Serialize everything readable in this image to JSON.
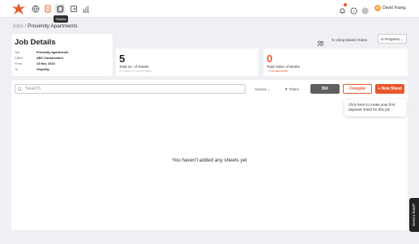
{
  "topbar": {
    "tooltip": "Sheets",
    "nav_icons": [
      "globe-icon",
      "document-icon",
      "sheets-icon",
      "export-icon",
      "chart-icon"
    ],
    "user": {
      "initials": "DY",
      "name": "David Young"
    },
    "accent": "#e8572a"
  },
  "breadcrumb": {
    "parent": "Jobs",
    "separator": "/",
    "current": "Proximity Apartments"
  },
  "job_details": {
    "title": "Job Details",
    "rows": [
      {
        "label": "Job",
        "value": "Proximity Apartments"
      },
      {
        "label": "Client",
        "value": "ABC Construction"
      },
      {
        "label": "From",
        "value": "13 Nov, 2024"
      },
      {
        "label": "To",
        "value": "Ongoing"
      }
    ]
  },
  "stats": {
    "sheets": {
      "value": "5",
      "label": "Total no. of sheets",
      "sub": "23 sheets in current stage"
    },
    "value_of_works": {
      "value": "0",
      "label": "Total Value of Works",
      "sub": "0 vs last month"
    }
  },
  "controls": {
    "master_rates": "Using Master Rates",
    "status": "In Progress"
  },
  "toolbar": {
    "search_placeholder": "Search",
    "actions": "Actions",
    "filters": "Filters",
    "bill": "Bill",
    "compile": "Compile",
    "new_sheet": "+ New Sheet"
  },
  "hint": "Click here to create your first daywork sheet for this job",
  "empty_message": "You haven't added any sheets yet",
  "feedback": "Need a hand?"
}
